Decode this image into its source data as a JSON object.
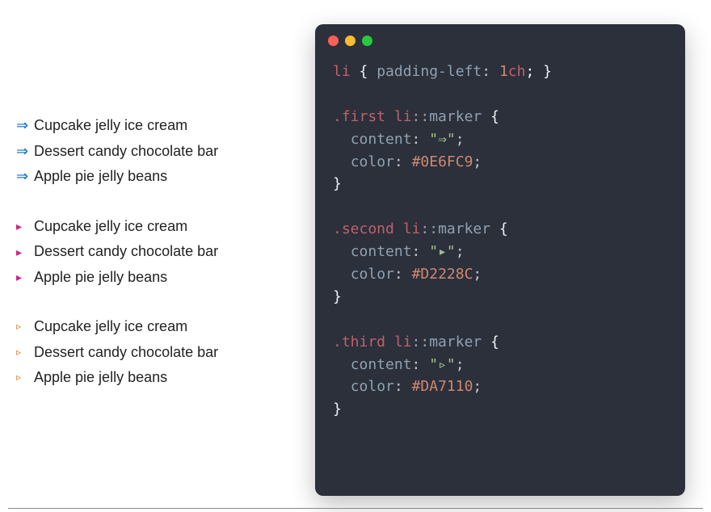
{
  "lists": {
    "first": {
      "marker": "⇒",
      "color": "#0E6FC9",
      "items": [
        "Cupcake jelly ice cream",
        "Dessert candy chocolate bar",
        "Apple pie jelly beans"
      ]
    },
    "second": {
      "marker": "▸",
      "color": "#D2228C",
      "items": [
        "Cupcake jelly ice cream",
        "Dessert candy chocolate bar",
        "Apple pie jelly beans"
      ]
    },
    "third": {
      "marker": "▹",
      "color": "#DA7110",
      "items": [
        "Cupcake jelly ice cream",
        "Dessert candy chocolate bar",
        "Apple pie jelly beans"
      ]
    }
  },
  "code": {
    "line1": {
      "selector": "li",
      "brace_open": " { ",
      "prop": "padding-left",
      "colon": ": ",
      "value": "1",
      "unit": "ch",
      "end": "; }"
    },
    "block1": {
      "selector_class": ".first ",
      "selector_el": "li",
      "pseudo": "::marker",
      "brace_open": " {",
      "content_prop": "content",
      "content_val": "\"⇒\"",
      "color_prop": "color",
      "color_val": "#0E6FC9",
      "brace_close": "}"
    },
    "block2": {
      "selector_class": ".second ",
      "selector_el": "li",
      "pseudo": "::marker",
      "brace_open": " {",
      "content_prop": "content",
      "content_val": "\"▸\"",
      "color_prop": "color",
      "color_val": "#D2228C",
      "brace_close": "}"
    },
    "block3": {
      "selector_class": ".third ",
      "selector_el": "li",
      "pseudo": "::marker",
      "brace_open": " {",
      "content_prop": "content",
      "content_val": "\"▹\"",
      "color_prop": "color",
      "color_val": "#DA7110",
      "brace_close": "}"
    }
  }
}
